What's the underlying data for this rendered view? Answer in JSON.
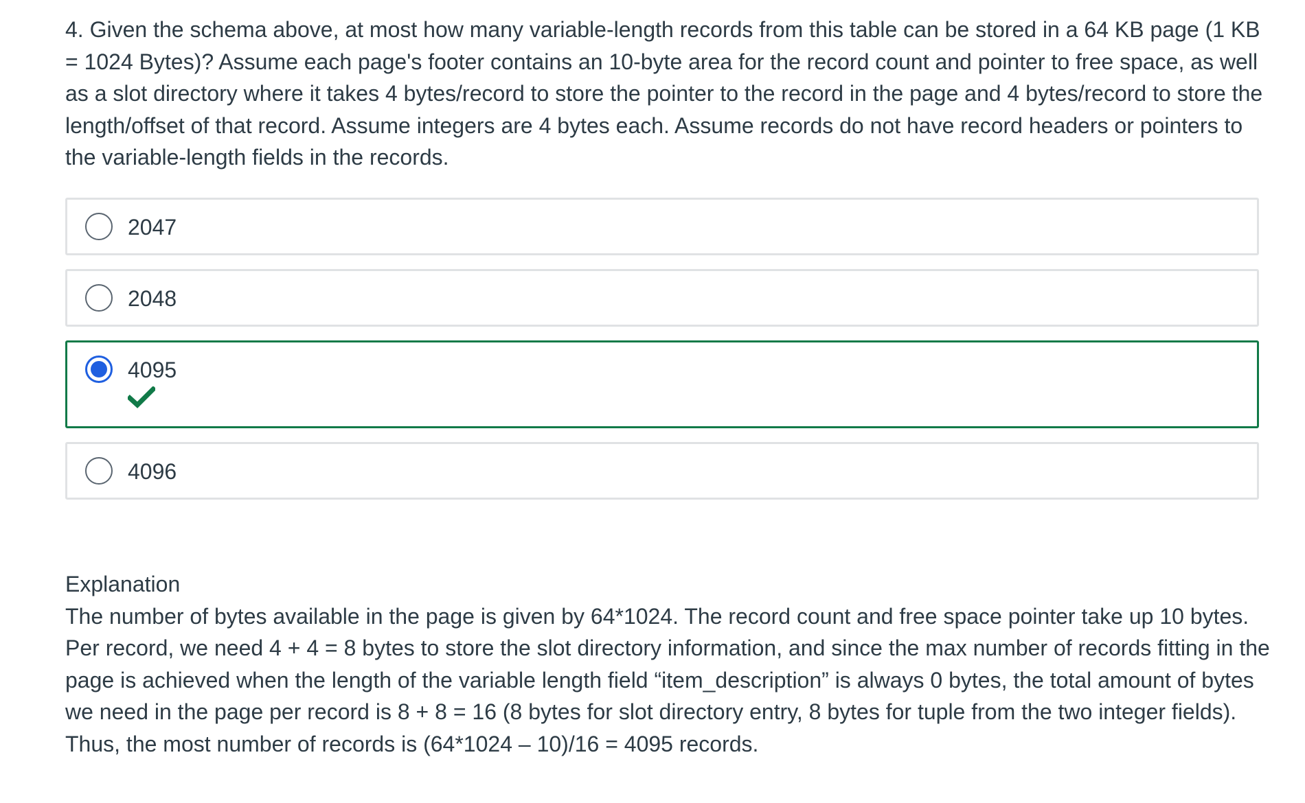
{
  "question": {
    "text": "4. Given the schema above, at most how many variable-length records from this table can be stored in a 64 KB page (1 KB = 1024 Bytes)? Assume each page's footer contains an 10-byte area for the record count and pointer to free space, as well as a slot directory where it takes 4 bytes/record to store the pointer to the record in the page and 4 bytes/record to store the length/offset of that record. Assume integers are 4 bytes each. Assume records do not have record headers or pointers to the variable-length fields in the records."
  },
  "answers": [
    {
      "label": "2047",
      "selected": false
    },
    {
      "label": "2048",
      "selected": false
    },
    {
      "label": "4095",
      "selected": true,
      "correct": true
    },
    {
      "label": "4096",
      "selected": false
    }
  ],
  "explanation": {
    "title": "Explanation",
    "text": "The number of bytes available in the page is given by 64*1024. The record count and free space pointer take up 10 bytes. Per record, we need 4 + 4 = 8 bytes to store the slot directory information, and since the max number of records fitting in the page is achieved when the length of the variable length field “item_description” is always 0 bytes, the total amount of bytes we need in the page per record is 8 + 8 = 16 (8 bytes for slot directory entry, 8 bytes for tuple from the two integer fields). Thus, the most number of records is (64*1024 – 10)/16 = 4095 records."
  },
  "colors": {
    "correct_border": "#117a48",
    "correct_check": "#117a48",
    "selected_radio": "#1f5fe0",
    "default_border": "#e0e2e4",
    "text": "#2d3b45"
  },
  "icons": {
    "correct": "checkmark-icon"
  }
}
